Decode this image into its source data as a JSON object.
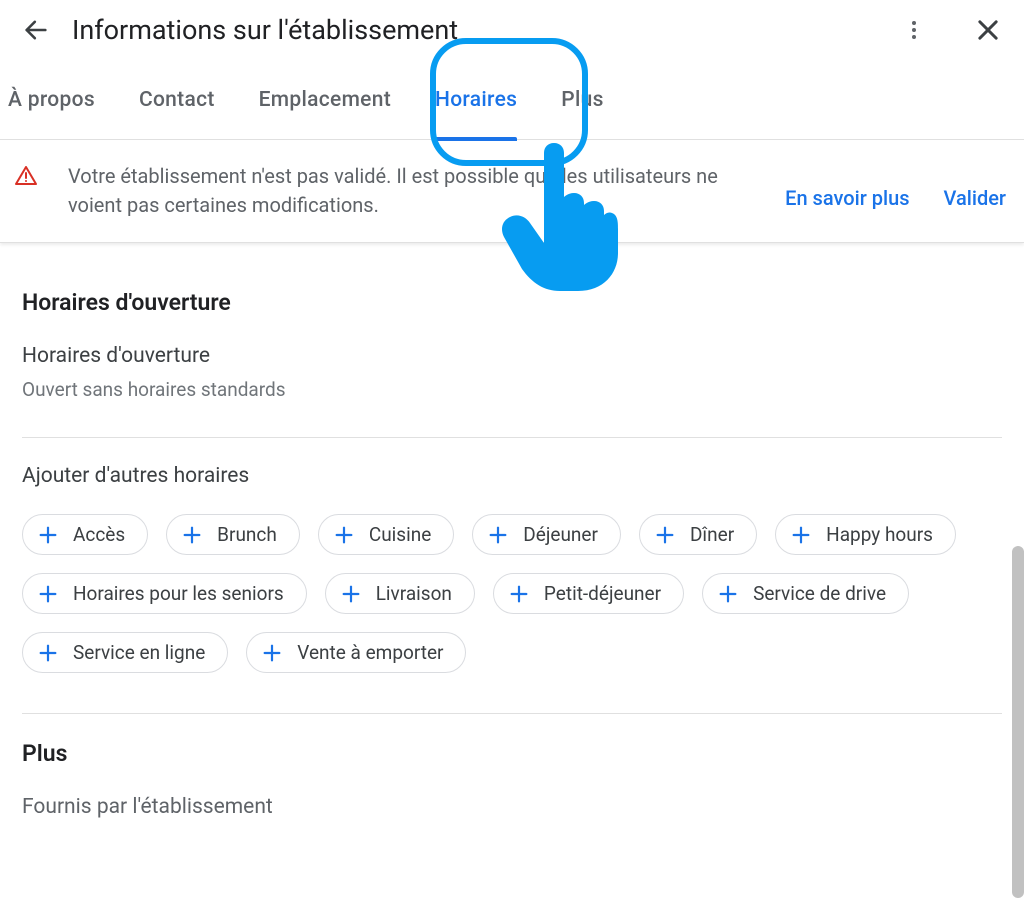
{
  "header": {
    "title": "Informations sur l'établissement"
  },
  "tabs": [
    {
      "label": "À propos",
      "active": false
    },
    {
      "label": "Contact",
      "active": false
    },
    {
      "label": "Emplacement",
      "active": false
    },
    {
      "label": "Horaires",
      "active": true
    },
    {
      "label": "Plus",
      "active": false
    }
  ],
  "alert": {
    "text": "Votre établissement n'est pas validé. Il est possible que les utilisateurs ne voient pas certaines modifications.",
    "learn_more": "En savoir plus",
    "validate": "Valider"
  },
  "hours": {
    "section_title": "Horaires d'ouverture",
    "sub_label": "Horaires d'ouverture",
    "sub_value": "Ouvert sans horaires standards",
    "add_label": "Ajouter d'autres horaires",
    "chips": [
      "Accès",
      "Brunch",
      "Cuisine",
      "Déjeuner",
      "Dîner",
      "Happy hours",
      "Horaires pour les seniors",
      "Livraison",
      "Petit-déjeuner",
      "Service de drive",
      "Service en ligne",
      "Vente à emporter"
    ]
  },
  "more": {
    "section_title": "Plus",
    "provided_by": "Fournis par l'établissement"
  }
}
